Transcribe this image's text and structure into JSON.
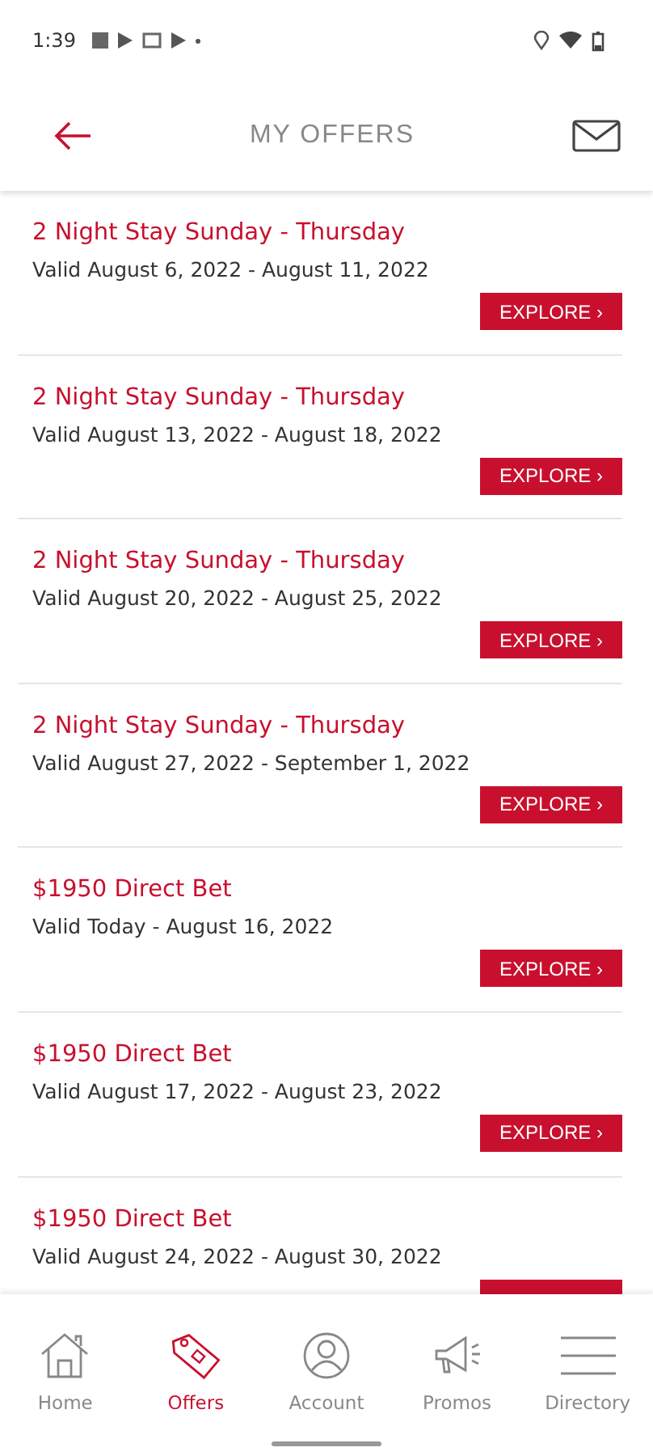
{
  "status_bar": {
    "time": "1:39"
  },
  "header": {
    "title": "MY OFFERS"
  },
  "offers": [
    {
      "title": "2 Night Stay Sunday - Thursday",
      "validity": "Valid August 6, 2022 - August 11, 2022",
      "button": "EXPLORE ›"
    },
    {
      "title": "2 Night Stay Sunday - Thursday",
      "validity": "Valid August 13, 2022 - August 18, 2022",
      "button": "EXPLORE ›"
    },
    {
      "title": "2 Night Stay Sunday - Thursday",
      "validity": "Valid August 20, 2022 - August 25, 2022",
      "button": "EXPLORE ›"
    },
    {
      "title": "2 Night Stay Sunday - Thursday",
      "validity": "Valid August 27, 2022 - September 1, 2022",
      "button": "EXPLORE ›"
    },
    {
      "title": "$1950 Direct Bet",
      "validity": "Valid Today - August 16, 2022",
      "button": "EXPLORE ›"
    },
    {
      "title": "$1950 Direct Bet",
      "validity": "Valid August 17, 2022 - August 23, 2022",
      "button": "EXPLORE ›"
    },
    {
      "title": "$1950 Direct Bet",
      "validity": "Valid August 24, 2022 - August 30, 2022"
    }
  ],
  "nav": [
    {
      "kind": "home",
      "label": "Home",
      "selected": false
    },
    {
      "kind": "offers",
      "label": "Offers",
      "selected": true
    },
    {
      "kind": "account",
      "label": "Account",
      "selected": false
    },
    {
      "kind": "promos",
      "label": "Promos",
      "selected": false
    },
    {
      "kind": "directory",
      "label": "Directory",
      "selected": false
    }
  ]
}
